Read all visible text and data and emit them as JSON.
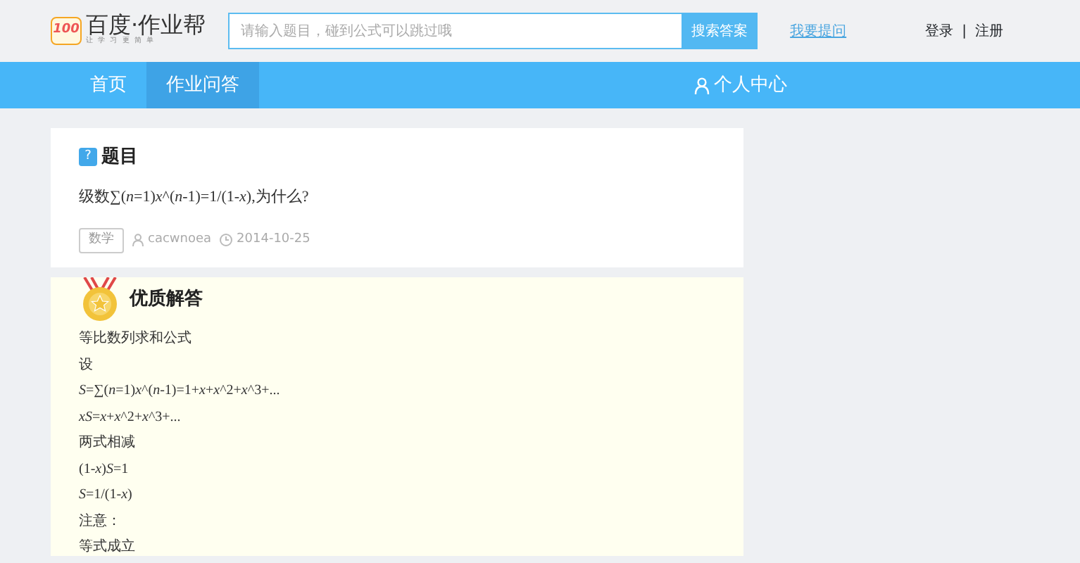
{
  "header": {
    "logo_badge": "100",
    "logo_title": "百度·作业帮",
    "logo_slogan": "让 学 习 更 简 单",
    "search": {
      "placeholder": "请输入题目，碰到公式可以跳过哦"
    },
    "search_button": "搜索答案",
    "ask_link": "我要提问",
    "login": "登录",
    "separator": "|",
    "register": "注册"
  },
  "nav": {
    "tabs": [
      {
        "label": "首页",
        "selected": false
      },
      {
        "label": "作业问答",
        "selected": true
      }
    ],
    "user_center": "个人中心"
  },
  "question": {
    "badge": "?",
    "title": "题目",
    "text": "级数∑(*n*=1)*x*^(*n*-1)=1/(1-*x*),为什么?",
    "tag": "数学",
    "author": "cacwnoea",
    "date": "2014-10-25"
  },
  "answer": {
    "title": "优质解答",
    "lines": [
      {
        "kind": "text",
        "text": "等比数列求和公式"
      },
      {
        "kind": "text",
        "text": "设"
      },
      {
        "kind": "math",
        "text": "*S*=∑(*n*=1)*x*^(*n*-1)=1+*x*+*x*^2+*x*^3+..."
      },
      {
        "kind": "math",
        "text": "*xS*=*x*+*x*^2+*x*^3+..."
      },
      {
        "kind": "text",
        "text": "两式相减"
      },
      {
        "kind": "math",
        "text": "(1-*x*)*S*=1"
      },
      {
        "kind": "math",
        "text": "*S*=1/(1-*x*)"
      },
      {
        "kind": "text",
        "text": "注意："
      },
      {
        "kind": "text",
        "text": "等式成立"
      }
    ]
  }
}
